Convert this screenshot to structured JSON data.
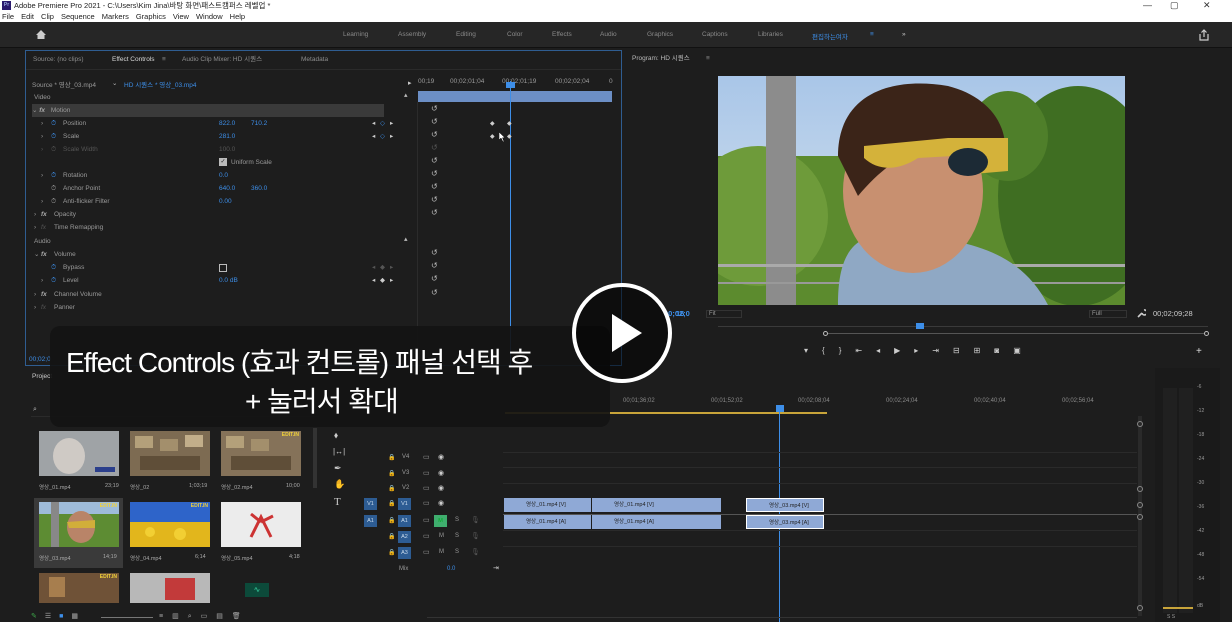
{
  "titlebar": {
    "title": "Adobe Premiere Pro 2021 - C:\\Users\\Kim Jina\\바탕 화면\\패스트캠퍼스 레벨업 *",
    "logo": "Pr",
    "minimize": "—",
    "restore": "▢",
    "close": "✕"
  },
  "menu": [
    "File",
    "Edit",
    "Clip",
    "Sequence",
    "Markers",
    "Graphics",
    "View",
    "Window",
    "Help"
  ],
  "workspaces": [
    "Learning",
    "Assembly",
    "Editing",
    "Color",
    "Effects",
    "Audio",
    "Graphics",
    "Captions",
    "Libraries"
  ],
  "active_workspace": "편집하는여자",
  "ec": {
    "tabs": {
      "source": "Source: (no clips)",
      "effect_controls": "Effect Controls",
      "mixer": "Audio Clip Mixer: HD 시퀀스",
      "metadata": "Metadata"
    },
    "source_sel": "Source * 영상_03.mp4",
    "seq_sel": "HD 시퀀스 * 영상_03.mp4",
    "ruler": [
      "00;19",
      "00;02;01;04",
      "00;02;01;19",
      "00;02;02;04",
      "0"
    ],
    "section_video": "Video",
    "section_audio": "Audio",
    "motion": "Motion",
    "position": "Position",
    "pos_x": "822.0",
    "pos_y": "710.2",
    "scale": "Scale",
    "scale_v": "281.0",
    "scale_width": "Scale Width",
    "scale_width_v": "100.0",
    "uniform": "Uniform Scale",
    "rotation": "Rotation",
    "rotation_v": "0.0",
    "anchor": "Anchor Point",
    "anchor_x": "640.0",
    "anchor_y": "360.0",
    "antiflicker": "Anti-flicker Filter",
    "antiflicker_v": "0.00",
    "opacity": "Opacity",
    "timeremap": "Time Remapping",
    "volume": "Volume",
    "bypass": "Bypass",
    "level": "Level",
    "level_v": "0.0 dB",
    "channel_volume": "Channel Volume",
    "panner": "Panner",
    "bottom_tc": "00;02;0"
  },
  "program": {
    "title": "Program: HD 시퀀스",
    "timecode": "00;02;0",
    "timecode_tail": "16",
    "fit": "Fit",
    "full": "Full",
    "duration": "00;02;09;28"
  },
  "project": {
    "tab": "Project",
    "items": [
      {
        "name": "영상_01.mp4",
        "dur": "23;19"
      },
      {
        "name": "영상_02",
        "dur": "1;03;19"
      },
      {
        "name": "영상_02.mp4",
        "dur": "10;00"
      },
      {
        "name": "영상_03.mp4",
        "dur": "14;19"
      },
      {
        "name": "영상_04.mp4",
        "dur": "6;14"
      },
      {
        "name": "영상_05.mp4",
        "dur": "4;18"
      }
    ],
    "edit_in": "EDIT.IN"
  },
  "timeline": {
    "ruler": [
      "00;01;36;02",
      "00;01;52;02",
      "00;02;08;04",
      "00;02;24;04",
      "00;02;40;04",
      "00;02;56;04"
    ],
    "tracks_v": [
      "V4",
      "V3",
      "V2",
      "V1"
    ],
    "tracks_a": [
      "A1",
      "A2",
      "A3"
    ],
    "src_v": "V1",
    "src_a": "A1",
    "mix": "Mix",
    "mix_v": "0.0",
    "m": "M",
    "s": "S",
    "clips_v": [
      "영상_01.mp4 [V]",
      "영상_01.mp4 [V]",
      "영상_03.mp4 [V]"
    ],
    "clips_a": [
      "영상_01.mp4 [A]",
      "영상_01.mp4 [A]",
      "영상_03.mp4 [A]"
    ]
  },
  "meter": {
    "labels": [
      "-6",
      "-12",
      "-18",
      "-24",
      "-30",
      "-36",
      "-42",
      "-48",
      "-54",
      "dB"
    ],
    "ss": "S S"
  },
  "caption": {
    "line1": "Effect Controls (효과 컨트롤) 패널 선택 후",
    "line2": "+ 눌러서 확대"
  },
  "colors": {
    "accent": "#3d8ee8",
    "clip_video": "#8fa9d6",
    "clip_audio": "#8fa9d6",
    "playhead": "#3d8ee8"
  }
}
